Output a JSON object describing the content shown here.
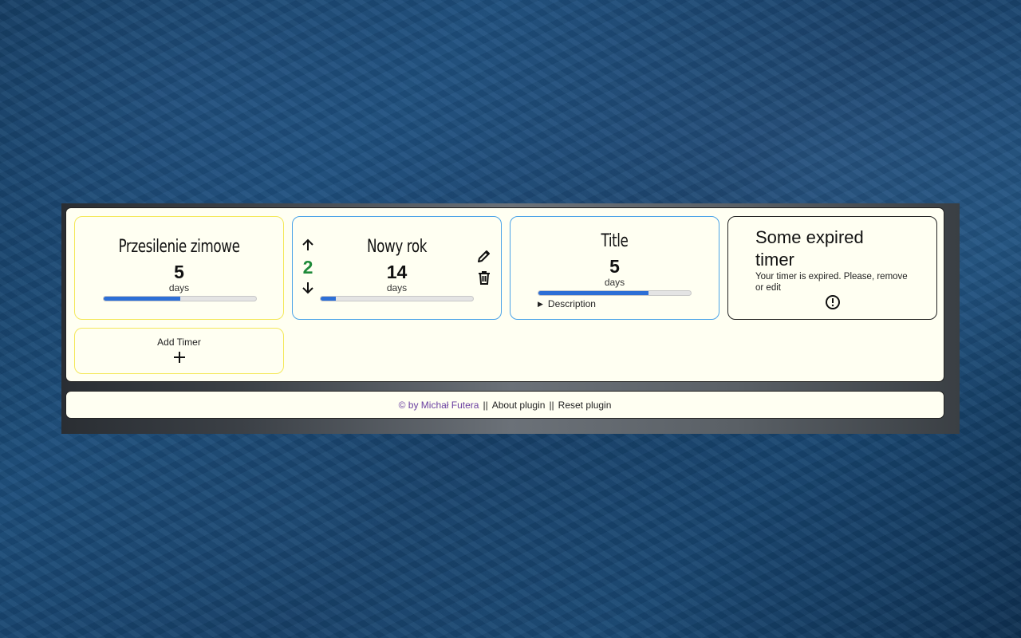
{
  "timers": [
    {
      "title": "Przesilenie zimowe",
      "value": "5",
      "unit": "days",
      "progress": 0.5
    },
    {
      "title": "Nowy rok",
      "value": "14",
      "unit": "days",
      "progress": 0.1,
      "order": "2",
      "up_icon": "arrow-up-icon",
      "down_icon": "arrow-down-icon",
      "edit_icon": "pencil-icon",
      "delete_icon": "trash-icon"
    },
    {
      "title": "Title",
      "value": "5",
      "unit": "days",
      "progress": 0.72,
      "description_label": "Description"
    },
    {
      "title": "Some expired timer",
      "message": "Your timer is expired. Please, remove or edit",
      "status_icon": "alert-circle-icon"
    }
  ],
  "add_timer": {
    "label": "Add Timer",
    "icon": "plus-icon"
  },
  "footer": {
    "author": "© by Michał Futera",
    "sep1": "||",
    "about": "About plugin",
    "sep2": "||",
    "reset": "Reset plugin"
  },
  "colors": {
    "accent_blue": "#2d6fd6",
    "order_green": "#1f8a3a",
    "author_purple": "#6a3fa0",
    "card_yellow_border": "#f4e85a",
    "card_blue_border": "#4aa3e8"
  }
}
